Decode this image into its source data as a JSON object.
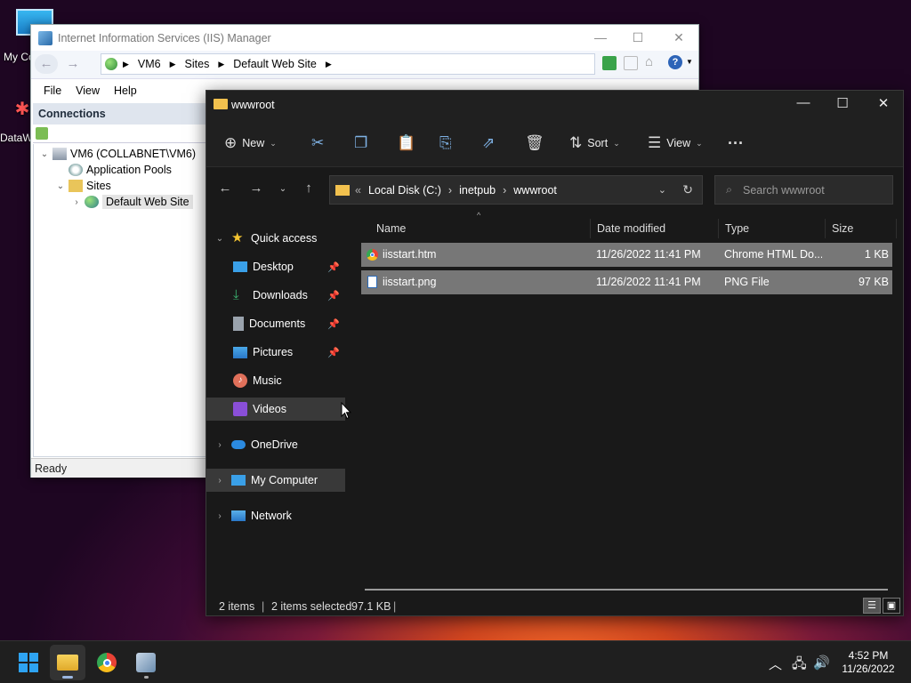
{
  "desktop": {
    "icons": [
      {
        "label": "My Co"
      },
      {
        "label": "DataW"
      }
    ]
  },
  "iis": {
    "title": "Internet Information Services (IIS) Manager",
    "address": {
      "segments": [
        "VM6",
        "Sites",
        "Default Web Site"
      ]
    },
    "menu": [
      "File",
      "View",
      "Help"
    ],
    "connections_title": "Connections",
    "tree": [
      {
        "label": "VM6 (COLLABNET\\VM6)"
      },
      {
        "label": "Application Pools"
      },
      {
        "label": "Sites"
      },
      {
        "label": "Default Web Site"
      }
    ],
    "status": "Ready"
  },
  "explorer": {
    "title": "wwwroot",
    "commands": {
      "new": "New",
      "sort": "Sort",
      "view": "View"
    },
    "address": {
      "segments": [
        "Local Disk (C:)",
        "inetpub",
        "wwwroot"
      ]
    },
    "search_placeholder": "Search wwwroot",
    "nav": {
      "quick_access": "Quick access",
      "desktop": "Desktop",
      "downloads": "Downloads",
      "documents": "Documents",
      "pictures": "Pictures",
      "music": "Music",
      "videos": "Videos",
      "onedrive": "OneDrive",
      "my_computer": "My Computer",
      "network": "Network"
    },
    "columns": {
      "name": "Name",
      "date": "Date modified",
      "type": "Type",
      "size": "Size"
    },
    "files": [
      {
        "name": "iisstart.htm",
        "date": "11/26/2022 11:41 PM",
        "type": "Chrome HTML Do...",
        "size": "1 KB"
      },
      {
        "name": "iisstart.png",
        "date": "11/26/2022 11:41 PM",
        "type": "PNG File",
        "size": "97 KB"
      }
    ],
    "status": {
      "items": "2 items",
      "selected": "2 items selected",
      "size": "97.1 KB"
    }
  },
  "taskbar": {
    "time": "4:52 PM",
    "date": "11/26/2022"
  },
  "colors": {
    "explorer_bg": "#191919",
    "selection": "#777777",
    "accent_blue": "#0078d4"
  }
}
